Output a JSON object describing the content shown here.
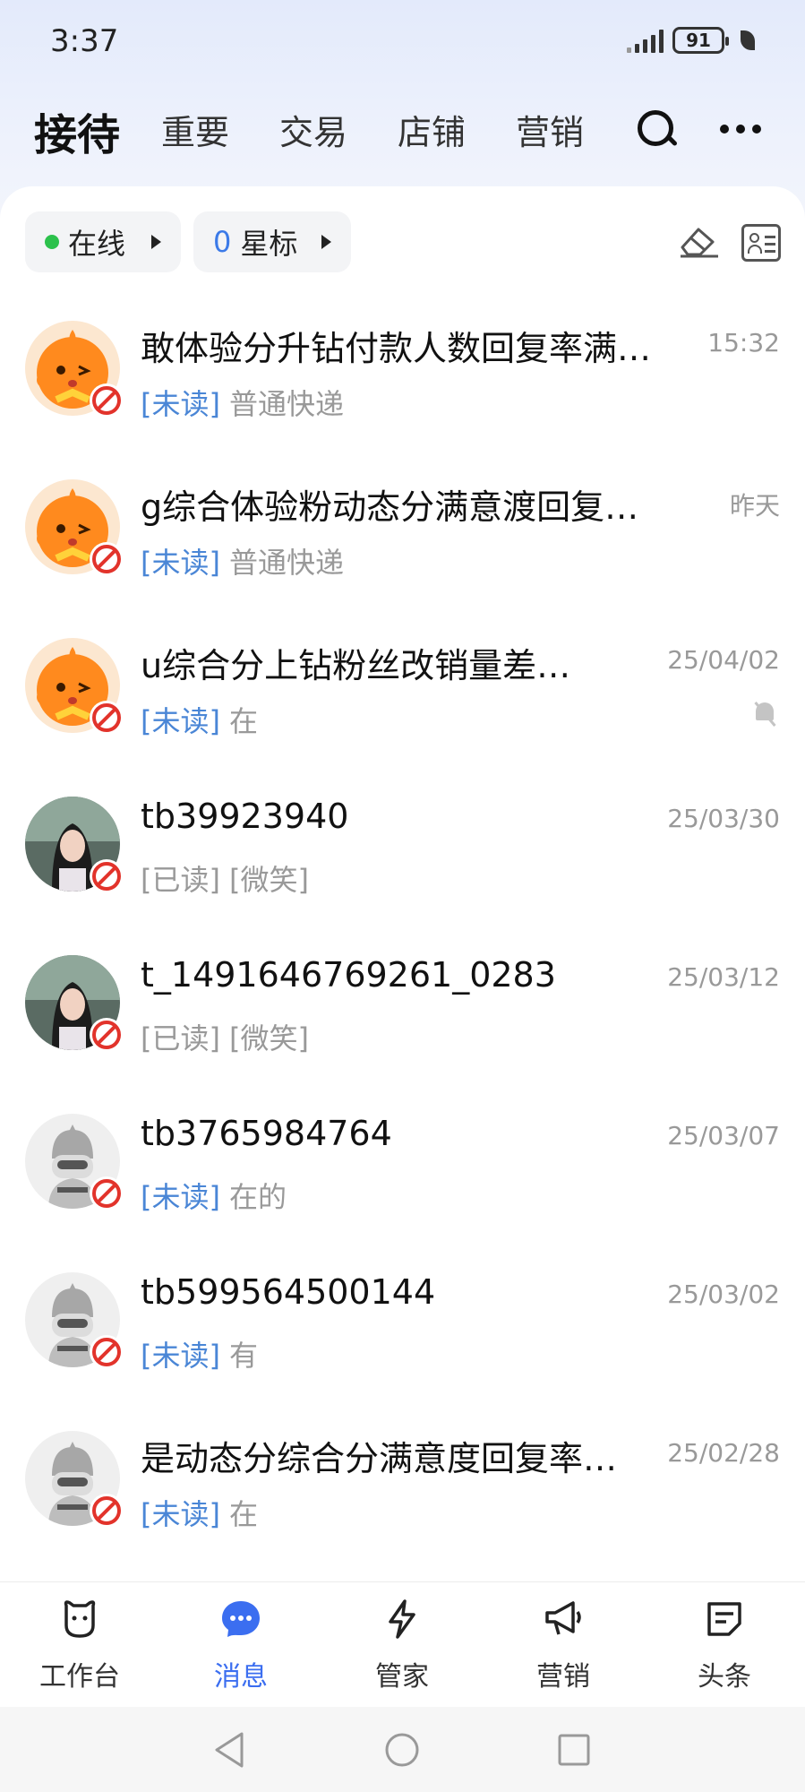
{
  "status_bar": {
    "time": "3:37",
    "battery": "91"
  },
  "top_tabs": [
    {
      "label": "接待",
      "active": true
    },
    {
      "label": "重要"
    },
    {
      "label": "交易"
    },
    {
      "label": "店铺"
    },
    {
      "label": "营销"
    }
  ],
  "filters": {
    "online_label": "在线",
    "star_count": "0",
    "star_label": "星标"
  },
  "conversations": [
    {
      "avatar": "mascot-avatar",
      "title": "敢体验分升钻付款人数回复率满…",
      "time": "15:32",
      "status": "[未读]",
      "status_type": "unread",
      "preview": "普通快递",
      "muted": false
    },
    {
      "avatar": "mascot-avatar",
      "title": "g综合体验粉动态分满意渡回复…",
      "time": "昨天",
      "status": "[未读]",
      "status_type": "unread",
      "preview": "普通快递",
      "muted": false
    },
    {
      "avatar": "mascot-avatar",
      "title": "u综合分上钻粉丝改销量差…",
      "time": "25/04/02",
      "status": "[未读]",
      "status_type": "unread",
      "preview": "在",
      "muted": true
    },
    {
      "avatar": "photo-avatar",
      "title": "tb39923940",
      "time": "25/03/30",
      "status": "[已读]",
      "status_type": "read",
      "preview": "[微笑]",
      "muted": false
    },
    {
      "avatar": "photo-avatar",
      "title": "t_1491646769261_0283",
      "time": "25/03/12",
      "status": "[已读]",
      "status_type": "read",
      "preview": "[微笑]",
      "muted": false
    },
    {
      "avatar": "default-avatar",
      "title": "tb3765984764",
      "time": "25/03/07",
      "status": "[未读]",
      "status_type": "unread",
      "preview": "在的",
      "muted": false
    },
    {
      "avatar": "default-avatar",
      "title": "tb599564500144",
      "time": "25/03/02",
      "status": "[未读]",
      "status_type": "unread",
      "preview": "有",
      "muted": false
    },
    {
      "avatar": "default-avatar",
      "title": "是动态分综合分满意度回复率…",
      "time": "25/02/28",
      "status": "[未读]",
      "status_type": "unread",
      "preview": "在",
      "muted": false
    }
  ],
  "bottom_nav": [
    {
      "label": "工作台",
      "icon": "workbench-icon"
    },
    {
      "label": "消息",
      "icon": "message-icon",
      "active": true
    },
    {
      "label": "管家",
      "icon": "lightning-icon"
    },
    {
      "label": "营销",
      "icon": "megaphone-icon"
    },
    {
      "label": "头条",
      "icon": "headline-icon"
    }
  ],
  "colors": {
    "accent": "#3b6ef0",
    "unread_tag": "#4a86d6",
    "online_dot": "#2cc14c",
    "blocked_red": "#e2332b"
  }
}
